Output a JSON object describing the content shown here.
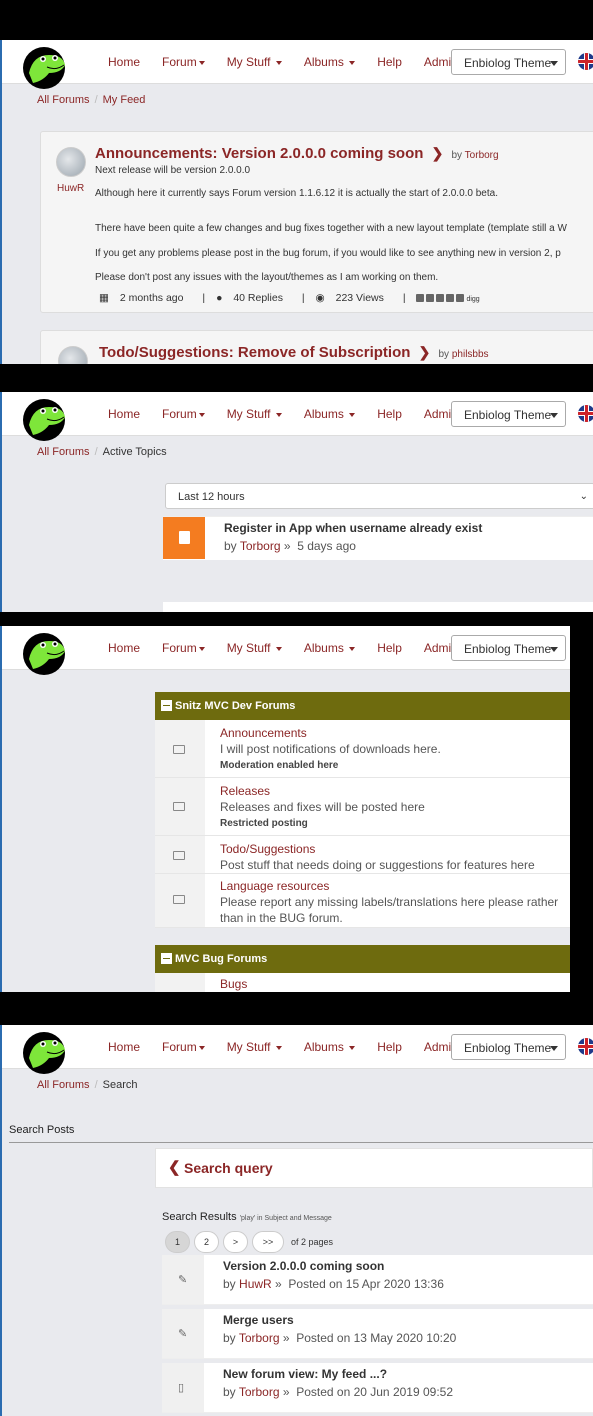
{
  "nav": {
    "items": [
      {
        "label": "Home",
        "dropdown": false
      },
      {
        "label": "Forum",
        "dropdown": true
      },
      {
        "label": "My Stuff",
        "dropdown": true
      },
      {
        "label": "Albums",
        "dropdown": true
      },
      {
        "label": "Help",
        "dropdown": false
      },
      {
        "label": "Admin",
        "dropdown": true
      }
    ],
    "theme": "Enbiolog Theme",
    "logo_icon": "frog-logo-icon",
    "flag_icon": "uk-flag-icon"
  },
  "feed": {
    "breadcrumb": {
      "root": "All Forums",
      "current": "My Feed"
    },
    "post1": {
      "forum": "Announcements",
      "colon": ":",
      "title": "Version 2.0.0.0 coming soon",
      "by_prefix": "by",
      "author": "Torborg",
      "avatar_user": "HuwR",
      "lines": [
        "Next release will be version 2.0.0.0",
        "Although here it currently says Forum version 1.1.6.12 it is actually the start of 2.0.0.0 beta.",
        "There have been quite a few changes and bug fixes together with a new layout template (template still a W",
        "If you get any problems please post in the bug forum, if you would like to see anything new in version 2, p",
        "Please don't post any issues with the layout/themes as I am working on them."
      ],
      "age": "2 months ago",
      "replies": "40 Replies",
      "views": "223 Views",
      "sep": "|",
      "digg": "digg"
    },
    "post2": {
      "forum": "Todo/Suggestions",
      "colon": ":",
      "title": "Remove of Subscription",
      "by_prefix": "by",
      "author": "philsbbs"
    }
  },
  "active": {
    "breadcrumb": {
      "root": "All Forums",
      "current": "Active Topics"
    },
    "range": "Last 12 hours",
    "topic": {
      "title": "Register in App when username already exist",
      "by_prefix": "by",
      "author": "Torborg",
      "sep": "»",
      "when": "5 days ago"
    }
  },
  "forums": {
    "categories": [
      {
        "name": "Snitz MVC Dev Forums"
      },
      {
        "name": "MVC Bug Forums"
      }
    ],
    "rows": [
      {
        "name": "Announcements",
        "desc": "I will post notifications of downloads here.",
        "note": "Moderation enabled here"
      },
      {
        "name": "Releases",
        "desc": "Releases and fixes will be posted here",
        "note": "Restricted posting"
      },
      {
        "name": "Todo/Suggestions",
        "desc": "Post stuff that needs doing or suggestions for features here",
        "note": ""
      },
      {
        "name": "Language resources",
        "desc": "Please report any missing labels/translations here please rather than in the BUG forum.",
        "note": ""
      }
    ],
    "bug_row": {
      "name": "Bugs"
    }
  },
  "search": {
    "breadcrumb": {
      "root": "All Forums",
      "current": "Search"
    },
    "section_label": "Search Posts",
    "query_title": "Search query",
    "results_label": "Search Results",
    "results_sub": "'play' in Subject and Message",
    "pages": [
      "1",
      "2",
      ">",
      ">>"
    ],
    "pages_text": "of 2 pages",
    "results": [
      {
        "title": "Version 2.0.0.0 coming soon",
        "by_prefix": "by",
        "author": "HuwR",
        "sep": "»",
        "posted": "Posted on 15 Apr 2020 13:36",
        "icon": "pin-icon"
      },
      {
        "title": "Merge users",
        "by_prefix": "by",
        "author": "Torborg",
        "sep": "»",
        "posted": "Posted on 13 May 2020 10:20",
        "icon": "pin-icon"
      },
      {
        "title": "New forum view: My feed ...?",
        "by_prefix": "by",
        "author": "Torborg",
        "sep": "»",
        "posted": "Posted on 20 Jun 2019 09:52",
        "icon": "document-icon"
      }
    ]
  },
  "colors": {
    "accent": "#8b2626",
    "category": "#6e6b0e",
    "topic_icon": "#f47c20"
  }
}
